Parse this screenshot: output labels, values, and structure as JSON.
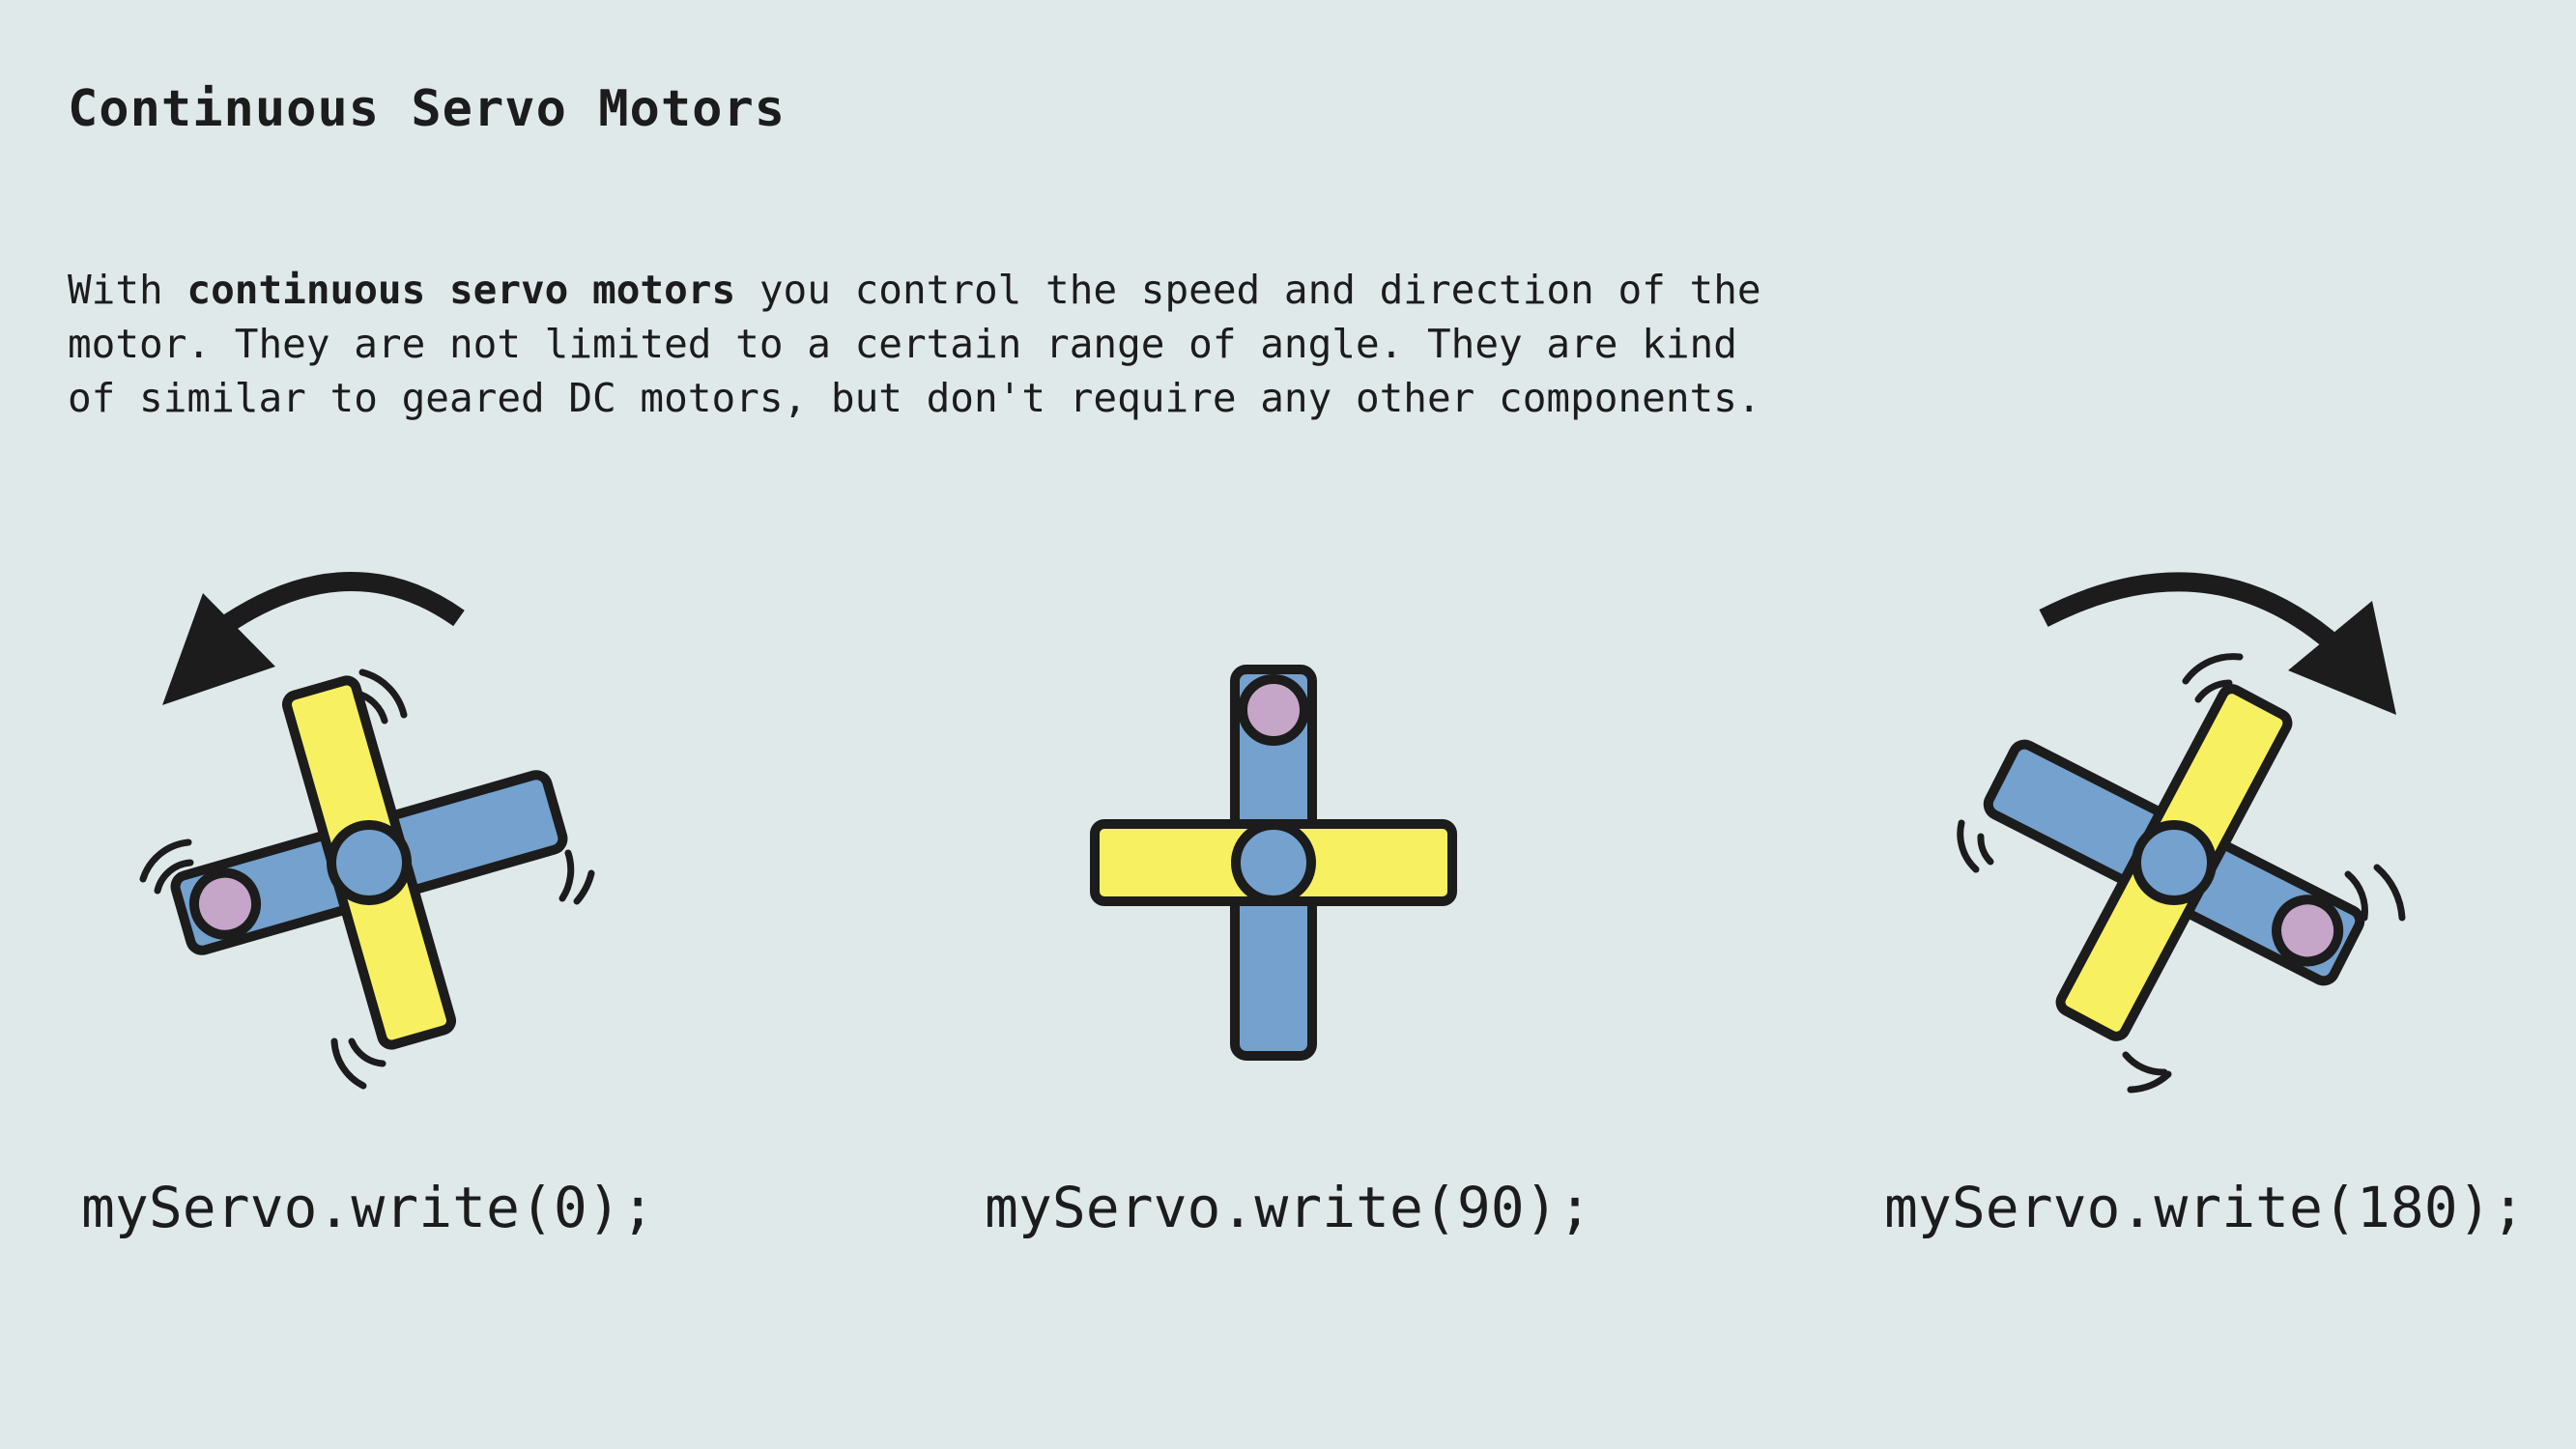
{
  "title": "Continuous Servo Motors",
  "intro": {
    "before": "With ",
    "bold": "continuous servo motors",
    "after": " you control the speed and direction of the\nmotor. They are not limited to a certain range of angle. They are kind\nof similar to geared DC motors, but don't require any other components."
  },
  "servos": [
    {
      "code": "myServo.write(0);",
      "rotation": "counterclockwise",
      "icon": "servo-horn-cross-icon"
    },
    {
      "code": "myServo.write(90);",
      "rotation": "stopped",
      "icon": "servo-horn-cross-icon"
    },
    {
      "code": "myServo.write(180);",
      "rotation": "clockwise",
      "icon": "servo-horn-cross-icon"
    }
  ],
  "colors": {
    "background": "#e0e9ea",
    "horn_blue": "#74a1cd",
    "horn_yellow": "#f7f061",
    "pin": "#c5a5c8",
    "outline": "#1c1c1c"
  }
}
